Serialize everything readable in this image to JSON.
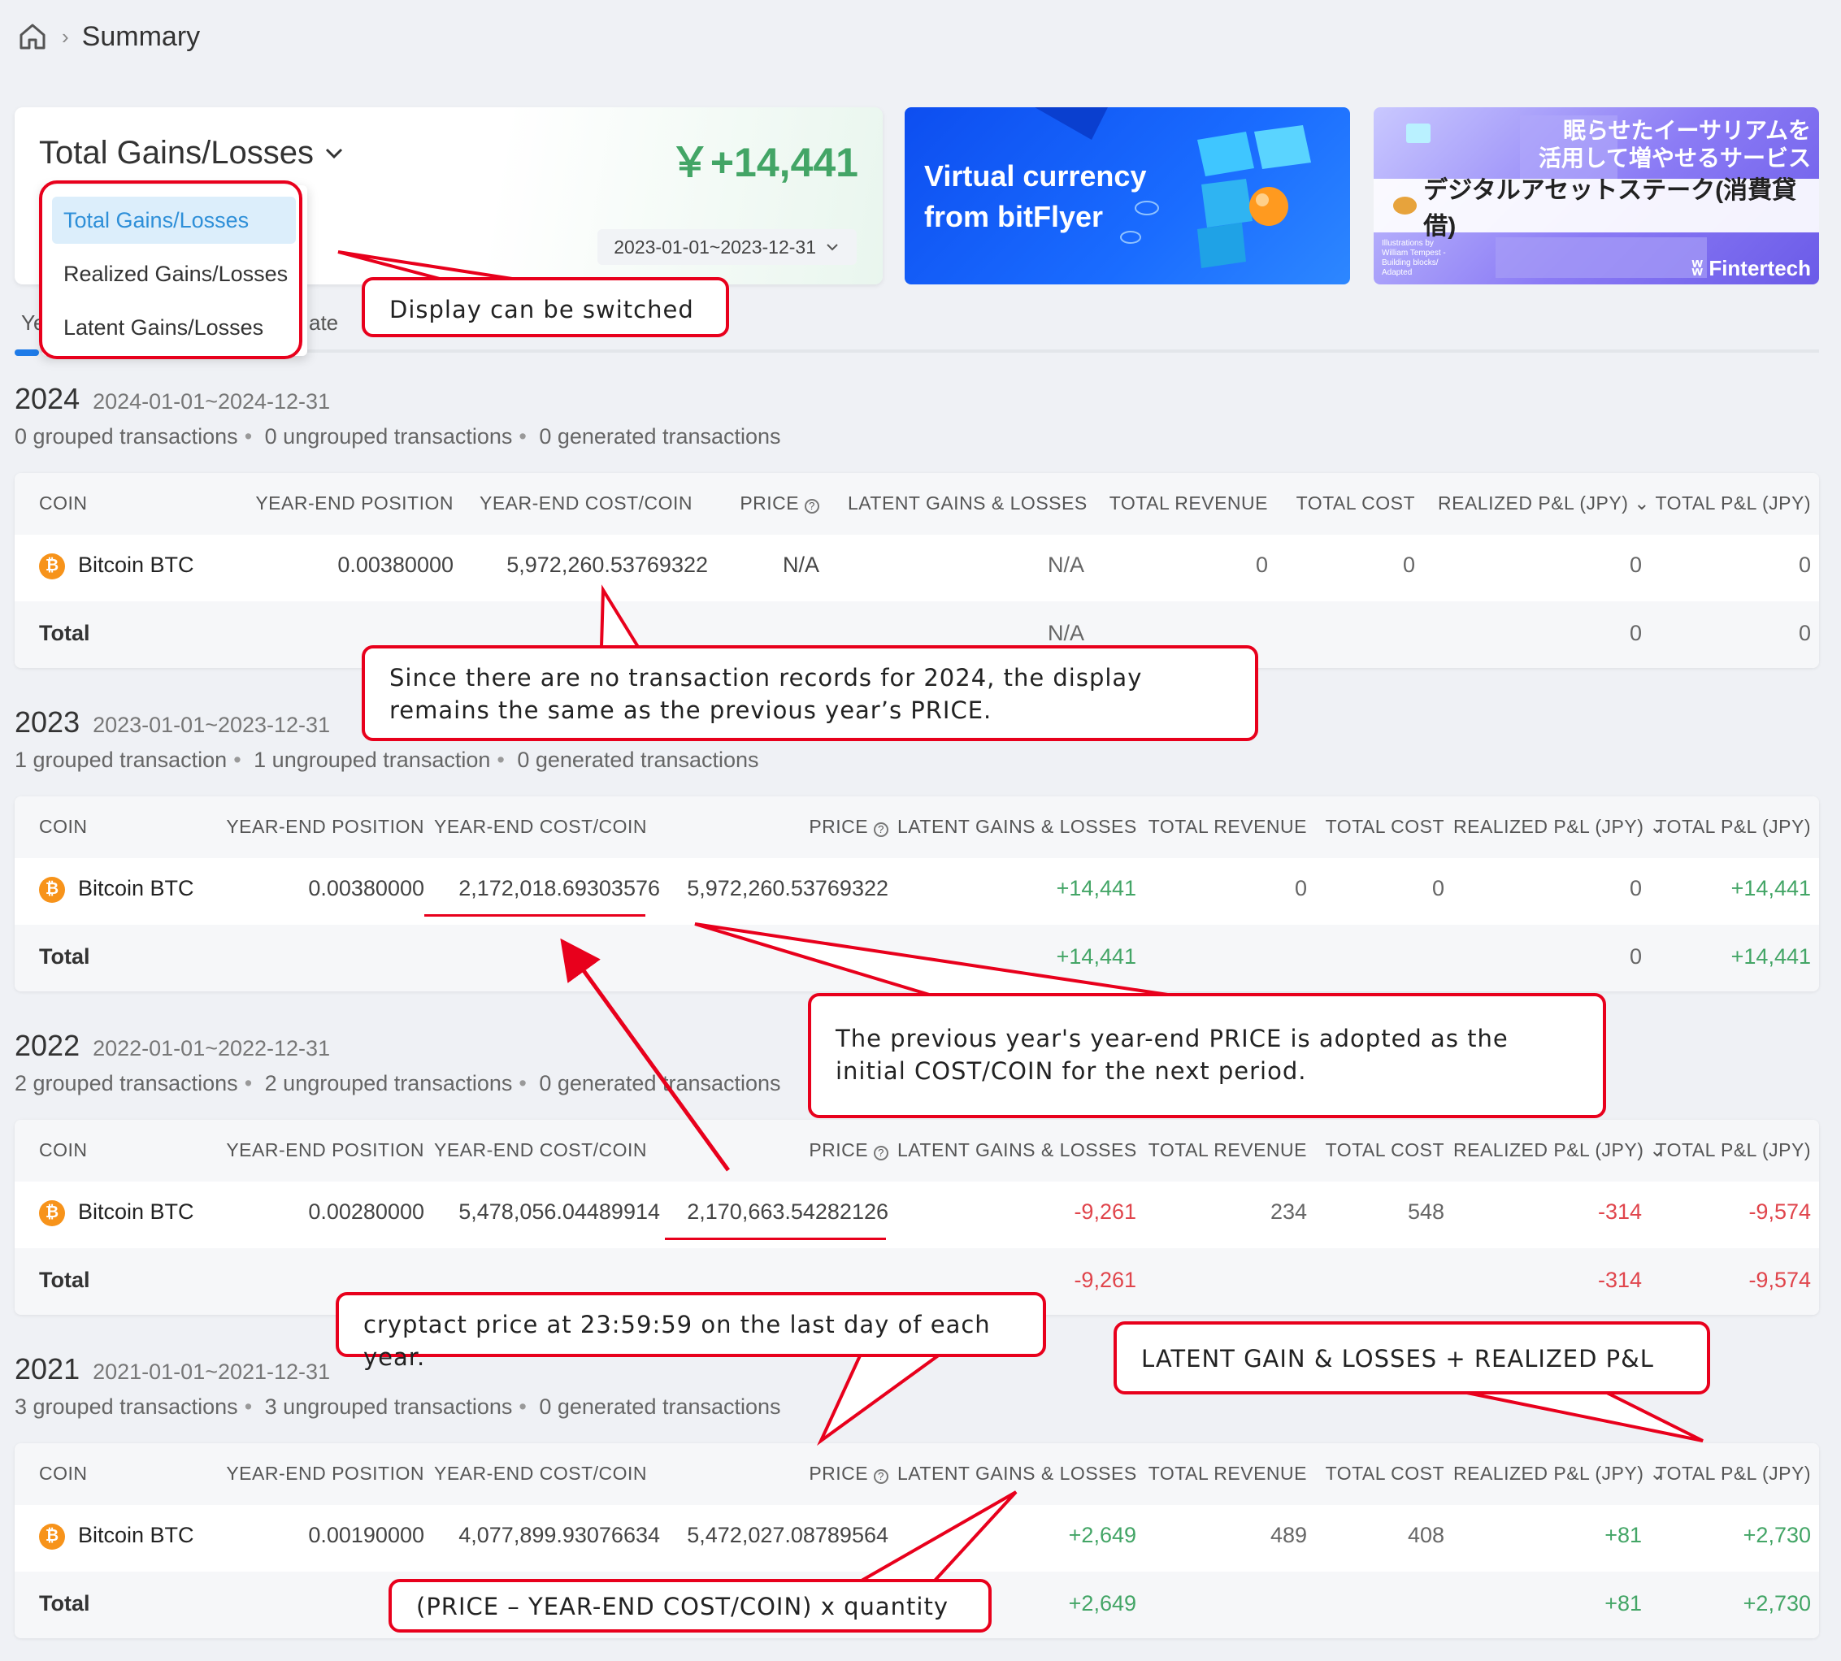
{
  "breadcrumb": {
    "current": "Summary"
  },
  "summary_card": {
    "title": "Total Gains/Losses",
    "value": "￥+14,441",
    "date_range": "2023-01-01~2023-12-31"
  },
  "dropdown": {
    "options": [
      "Total Gains/Losses",
      "Realized Gains/Losses",
      "Latent Gains/Losses"
    ]
  },
  "tabs": {
    "partial_left": "Ye",
    "partial_right": "ate"
  },
  "banners": {
    "bitflyer": {
      "line1": "Virtual currency",
      "line2": "from bitFlyer"
    },
    "fintertech": {
      "jp_line1": "眠らせたイーサリアムを",
      "jp_line2": "活用して増やせるサービス",
      "strip": "デジタルアセットステーク(消費貸借)",
      "brand": "Fintertech",
      "credit": "Illustrations by William Tempest - Building blocks/ Adapted"
    }
  },
  "table_headers": {
    "coin": "COIN",
    "position": "YEAR-END POSITION",
    "cost": "YEAR-END COST/COIN",
    "price": "PRICE",
    "latent": "LATENT GAINS & LOSSES",
    "revenue": "TOTAL REVENUE",
    "total_cost": "TOTAL COST",
    "realized": "REALIZED P&L (JPY)",
    "total_pl": "TOTAL P&L (JPY)"
  },
  "coin_label": "Bitcoin BTC",
  "total_label": "Total",
  "years": [
    {
      "year": "2024",
      "range": "2024-01-01~2024-12-31",
      "grouped": "0 grouped transactions",
      "ungrouped": "0 ungrouped transactions",
      "generated": "0 generated transactions",
      "row": {
        "position": "0.00380000",
        "cost": "5,972,260.53769322",
        "price": "N/A",
        "latent": "N/A",
        "revenue": "0",
        "total_cost": "0",
        "realized": "0",
        "total_pl": "0"
      },
      "total": {
        "latent": "N/A",
        "realized": "0",
        "total_pl": "0"
      }
    },
    {
      "year": "2023",
      "range": "2023-01-01~2023-12-31",
      "grouped": "1 grouped transaction",
      "ungrouped": "1 ungrouped transaction",
      "generated": "0 generated transactions",
      "row": {
        "position": "0.00380000",
        "cost": "2,172,018.69303576",
        "price": "5,972,260.53769322",
        "latent": "+14,441",
        "revenue": "0",
        "total_cost": "0",
        "realized": "0",
        "total_pl": "+14,441"
      },
      "total": {
        "latent": "+14,441",
        "realized": "0",
        "total_pl": "+14,441"
      }
    },
    {
      "year": "2022",
      "range": "2022-01-01~2022-12-31",
      "grouped": "2 grouped transactions",
      "ungrouped": "2 ungrouped transactions",
      "generated": "0 generated transactions",
      "row": {
        "position": "0.00280000",
        "cost": "5,478,056.04489914",
        "price": "2,170,663.54282126",
        "latent": "-9,261",
        "revenue": "234",
        "total_cost": "548",
        "realized": "-314",
        "total_pl": "-9,574"
      },
      "total": {
        "latent": "-9,261",
        "realized": "-314",
        "total_pl": "-9,574"
      }
    },
    {
      "year": "2021",
      "range": "2021-01-01~2021-12-31",
      "grouped": "3 grouped transactions",
      "ungrouped": "3 ungrouped transactions",
      "generated": "0 generated transactions",
      "row": {
        "position": "0.00190000",
        "cost": "4,077,899.93076634",
        "price": "5,472,027.08789564",
        "latent": "+2,649",
        "revenue": "489",
        "total_cost": "408",
        "realized": "+81",
        "total_pl": "+2,730"
      },
      "total": {
        "latent": "+2,649",
        "realized": "+81",
        "total_pl": "+2,730"
      }
    }
  ],
  "callouts": {
    "switch": "Display can be switched",
    "no_records": "Since there are no transaction records for 2024, the display remains the same as the previous year’s PRICE.",
    "adopted": "The previous year's year-end PRICE is adopted as the initial COST/COIN for the next period.",
    "cryptact": "cryptact price at 23:59:59 on the last day of each year.",
    "total_formula": "LATENT GAIN & LOSSES + REALIZED P&L",
    "latent_formula": "(PRICE – YEAR-END COST/COIN) x quantity"
  },
  "colors": {
    "positive": "#43a566",
    "negative": "#e0454c",
    "accent": "#1e7be8",
    "callout": "#e8001c"
  }
}
